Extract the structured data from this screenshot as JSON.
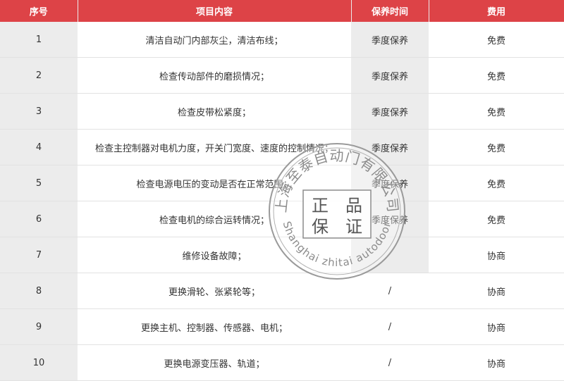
{
  "headers": [
    "序号",
    "项目内容",
    "保养时间",
    "费用"
  ],
  "rows": [
    {
      "no": "1",
      "item": "清洁自动门内部灰尘，清洁布线；",
      "time": "季度保养",
      "fee": "免费"
    },
    {
      "no": "2",
      "item": "检查传动部件的磨损情况；",
      "time": "季度保养",
      "fee": "免费"
    },
    {
      "no": "3",
      "item": "检查皮带松紧度；",
      "time": "季度保养",
      "fee": "免费"
    },
    {
      "no": "4",
      "item": "检查主控制器对电机力度，开关门宽度、速度的控制情况；",
      "time": "季度保养",
      "fee": "免费"
    },
    {
      "no": "5",
      "item": "检查电源电压的变动是否在正常范围；",
      "time": "季度保养",
      "fee": "免费"
    },
    {
      "no": "6",
      "item": "检查电机的综合运转情况；",
      "time": "季度保养",
      "fee": "免费"
    },
    {
      "no": "7",
      "item": "维修设备故障；",
      "time": "",
      "fee": "协商"
    },
    {
      "no": "8",
      "item": "更换滑轮、张紧轮等；",
      "time": "/",
      "fee": "协商"
    },
    {
      "no": "9",
      "item": "更换主机、控制器、传感器、电机；",
      "time": "/",
      "fee": "协商"
    },
    {
      "no": "10",
      "item": "更换电源变压器、轨道；",
      "time": "/",
      "fee": "协商"
    }
  ],
  "stamp": {
    "top_text": "上海至泰自动门有限公司",
    "bottom_text": "Shanghai zhitai autodoor",
    "center_chars": [
      "正",
      "品",
      "保",
      "证"
    ]
  },
  "colors": {
    "header_bg": "#dd4347",
    "gray_col": "#ececec"
  }
}
